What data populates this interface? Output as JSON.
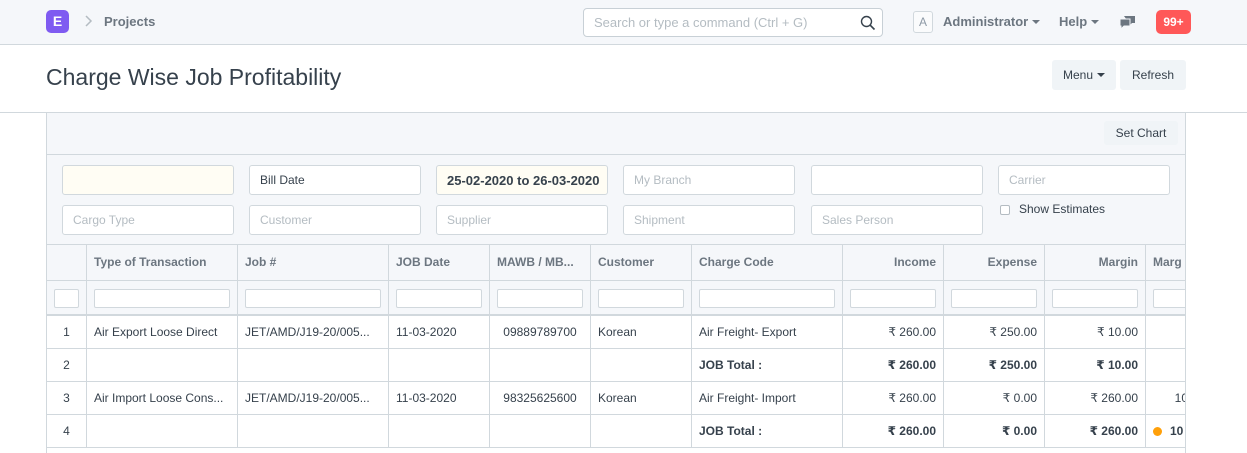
{
  "navbar": {
    "logo_letter": "E",
    "breadcrumb": "Projects",
    "search_placeholder": "Search or type a command (Ctrl + G)",
    "avatar_letter": "A",
    "user_menu": "Administrator",
    "help_menu": "Help",
    "notification_count": "99+"
  },
  "page": {
    "title": "Charge Wise Job Profitability",
    "menu_button": "Menu",
    "refresh_button": "Refresh",
    "set_chart_button": "Set Chart"
  },
  "filters": {
    "company": "",
    "date_type": "Bill Date",
    "date_range": "25-02-2020 to 26-03-2020",
    "branch_placeholder": "My Branch",
    "blank_filter": "",
    "carrier_placeholder": "Carrier",
    "cargo_type_placeholder": "Cargo Type",
    "customer_placeholder": "Customer",
    "supplier_placeholder": "Supplier",
    "shipment_placeholder": "Shipment",
    "sales_person_placeholder": "Sales Person",
    "show_estimates_label": "Show Estimates"
  },
  "table": {
    "columns": [
      "",
      "Type of Transaction",
      "Job #",
      "JOB Date",
      "MAWB / MB...",
      "Customer",
      "Charge Code",
      "Income",
      "Expense",
      "Margin",
      "Marg"
    ],
    "rows": [
      {
        "no": "1",
        "type": "Air Export Loose Direct",
        "job": "JET/AMD/J19-20/005...",
        "date": "11-03-2020",
        "mawb": "09889789700",
        "customer": "Korean",
        "charge": "Air Freight- Export",
        "income": "₹ 260.00",
        "expense": "₹ 250.00",
        "margin": "₹ 10.00",
        "marg": ""
      },
      {
        "no": "2",
        "type": "",
        "job": "",
        "date": "",
        "mawb": "",
        "customer": "",
        "charge": "JOB Total :",
        "income": "₹ 260.00",
        "expense": "₹ 250.00",
        "margin": "₹ 10.00",
        "marg": ""
      },
      {
        "no": "3",
        "type": "Air Import Loose Cons...",
        "job": "JET/AMD/J19-20/005...",
        "date": "11-03-2020",
        "mawb": "98325625600",
        "customer": "Korean",
        "charge": "Air Freight- Import",
        "income": "₹ 260.00",
        "expense": "₹ 0.00",
        "margin": "₹ 260.00",
        "marg": "10"
      },
      {
        "no": "4",
        "type": "",
        "job": "",
        "date": "",
        "mawb": "",
        "customer": "",
        "charge": "JOB Total :",
        "income": "₹ 260.00",
        "expense": "₹ 0.00",
        "margin": "₹ 260.00",
        "marg": "10"
      }
    ]
  },
  "colors": {
    "brand": "#7f5bf1",
    "notification": "#ff5858",
    "indicator_orange": "#ffa00a"
  }
}
